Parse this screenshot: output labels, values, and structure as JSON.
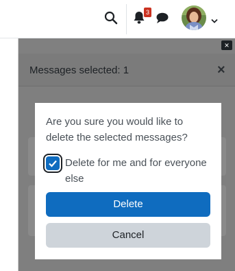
{
  "navbar": {
    "notification_count": "3"
  },
  "drawer": {
    "close_small_label": "×",
    "selected_text": "Messages selected: 1",
    "close_label": "×"
  },
  "modal": {
    "question": "Are you sure you would like to delete the selected messages?",
    "checkbox_label": "Delete for me and for everyone else",
    "checkbox_checked": true,
    "delete_label": "Delete",
    "cancel_label": "Cancel"
  },
  "colors": {
    "primary": "#0f6cbf",
    "badge": "#ca3120",
    "cancel": "#ced4da"
  }
}
